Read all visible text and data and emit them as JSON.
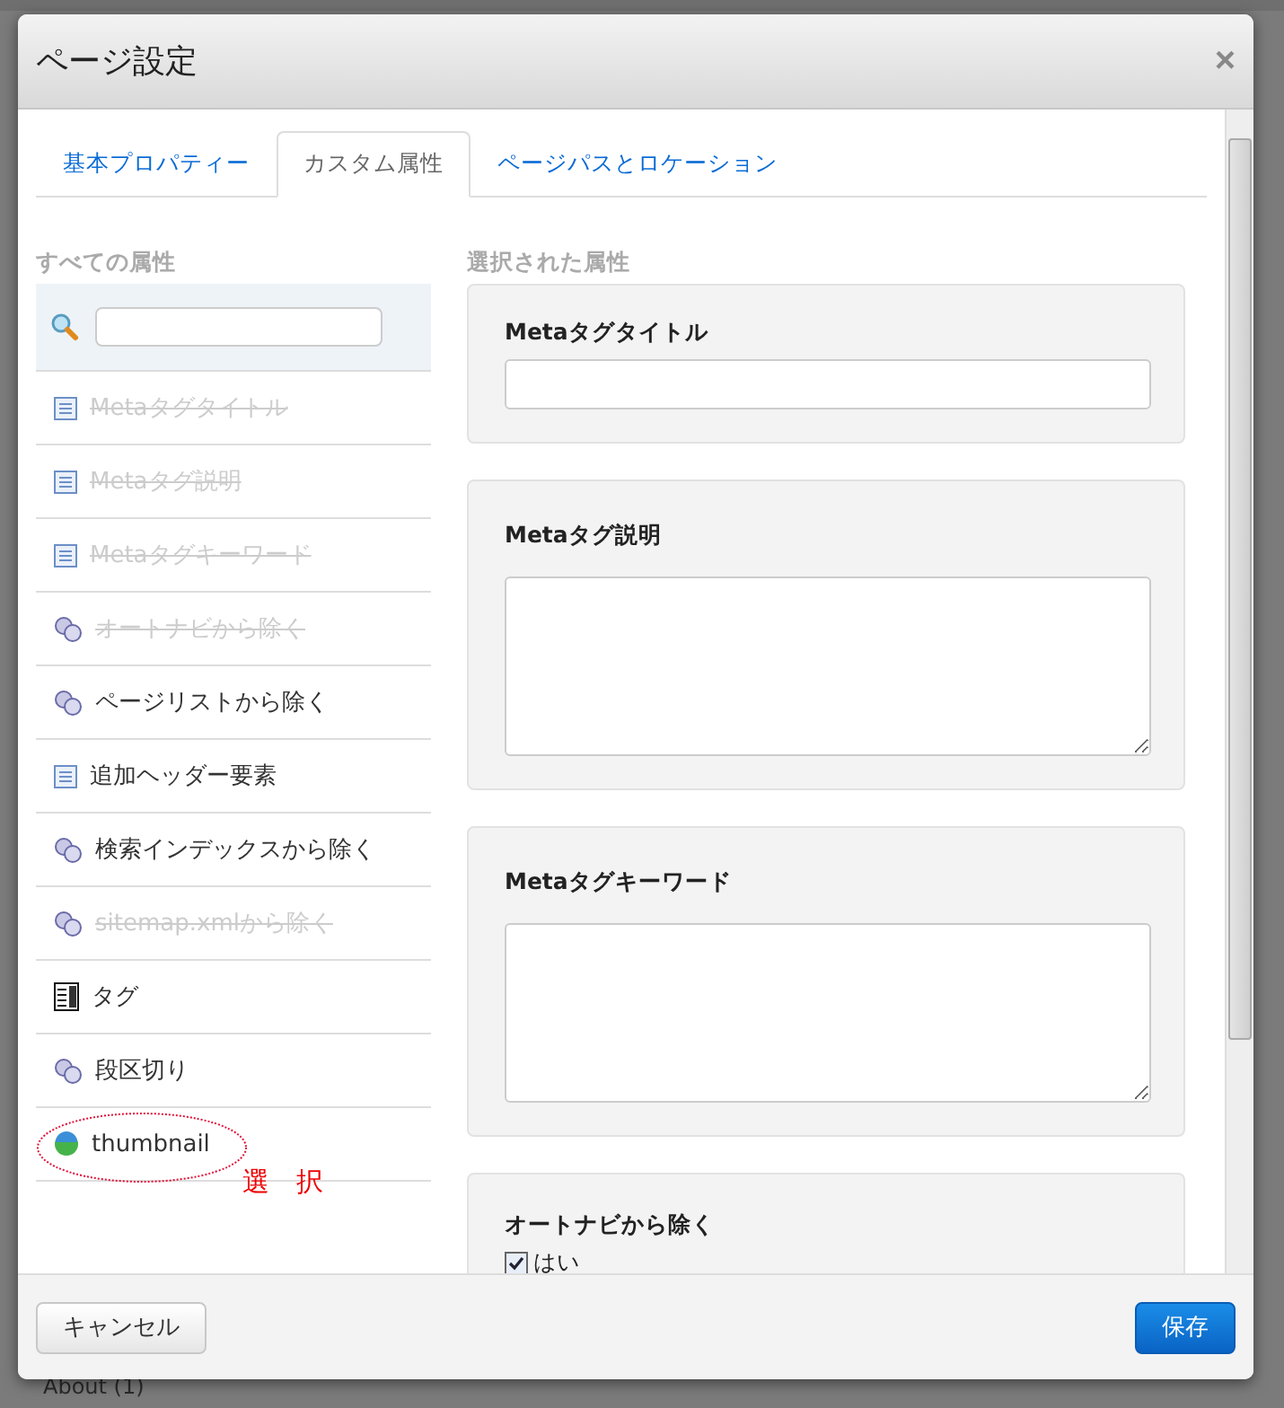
{
  "backdrop": {
    "footer_text": "About (1)"
  },
  "dialog": {
    "title": "ページ設定",
    "close": "×"
  },
  "tabs": [
    {
      "label": "基本プロパティー",
      "selected": false
    },
    {
      "label": "カスタム属性",
      "selected": true
    },
    {
      "label": "ページパスとロケーション",
      "selected": false
    }
  ],
  "all_attributes": {
    "heading": "すべての属性",
    "items": [
      {
        "label": "Metaタグタイトル",
        "kind": "text",
        "disabled": true
      },
      {
        "label": "Metaタグ説明",
        "kind": "text",
        "disabled": true
      },
      {
        "label": "Metaタグキーワード",
        "kind": "text",
        "disabled": true
      },
      {
        "label": "オートナビから除く",
        "kind": "boolean",
        "disabled": true
      },
      {
        "label": "ページリストから除く",
        "kind": "boolean",
        "disabled": false
      },
      {
        "label": "追加ヘッダー要素",
        "kind": "text",
        "disabled": false
      },
      {
        "label": "検索インデックスから除く",
        "kind": "boolean",
        "disabled": false
      },
      {
        "label": "sitemap.xmlから除く",
        "kind": "boolean",
        "disabled": true
      },
      {
        "label": "タグ",
        "kind": "select",
        "disabled": false
      },
      {
        "label": "段区切り",
        "kind": "boolean",
        "disabled": false
      },
      {
        "label": "thumbnail",
        "kind": "image",
        "disabled": false,
        "circled": true
      }
    ]
  },
  "annotation": {
    "text": "選　択"
  },
  "selected_attributes": {
    "heading": "選択された属性",
    "fields": [
      {
        "label": "Metaタグタイトル",
        "kind": "input"
      },
      {
        "label": "Metaタグ説明",
        "kind": "textarea"
      },
      {
        "label": "Metaタグキーワード",
        "kind": "textarea"
      },
      {
        "label": "オートナビから除く",
        "kind": "checkbox",
        "option": "はい",
        "checked": true
      }
    ]
  },
  "buttons": {
    "cancel": "キャンセル",
    "save": "保存"
  }
}
